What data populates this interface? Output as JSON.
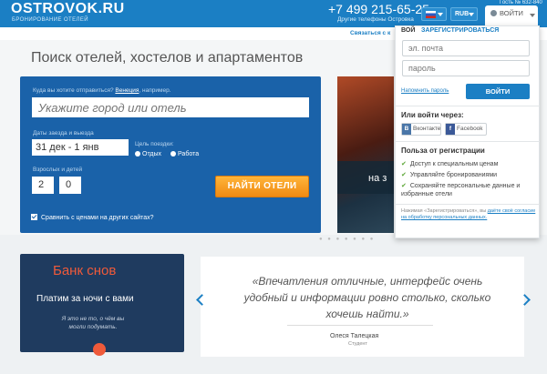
{
  "header": {
    "logo": "OSTROVOK.RU",
    "tagline": "БРОНИРОВАНИЕ ОТЕЛЕЙ",
    "phone": "+7 499 215-65-25",
    "phones_link": "Другие телефоны Островка",
    "currency": "RUB",
    "login_label": "ВОЙТИ",
    "guest_id": "Гость № 632-840",
    "contact_link": "Связаться с к"
  },
  "search": {
    "title": "Поиск отелей, хостелов и апартаментов",
    "dest_label_prefix": "Куда вы хотите отправиться?",
    "dest_example": "Венеция",
    "dest_label_suffix": ", например.",
    "dest_placeholder": "Укажите город или отель",
    "dates_label": "Даты заезда и выезда",
    "dates_value": "31 дек  -  1 янв",
    "purpose_label": "Цель поездки:",
    "purpose_options": [
      "Отдых",
      "Работа"
    ],
    "guests_label": "Взрослых и детей",
    "adults": "2",
    "kids": "0",
    "find_button": "НАЙТИ ОТЕЛИ",
    "compare_label": "Сравнить с ценами на других сайтах?"
  },
  "promo": {
    "text": "на з"
  },
  "bank": {
    "title": "Банк снов",
    "subtitle": "Платим за ночи с вами",
    "note": "Я это не то, о чём вы могли подумать."
  },
  "review": {
    "quote": "«Впечатления отличные, интерфейс очень удобный и информации ровно столько, сколько хочешь найти.»",
    "author": "Олеся Талецкая",
    "role": "Студент"
  },
  "login_panel": {
    "tab_login": "ВОЙ",
    "tab_register": "ЗАРЕГИСТРИРОВАТЬСЯ",
    "email_placeholder": "эл. почта",
    "password_placeholder": "пароль",
    "forgot": "Напомнить пароль",
    "submit": "ВОЙТИ",
    "or_label": "Или войти через:",
    "vk": "Вконтакте",
    "fb": "Facebook",
    "benefits_title": "Польза от регистрации",
    "benefits": [
      "Доступ к специальным ценам",
      "Управляйте бронированиями",
      "Сохраняйте персональные данные и избранные отели"
    ],
    "terms_prefix": "Нажимая «Зарегистрироваться», вы",
    "terms_link": "даёте своё согласие на обработку персональных данных."
  }
}
